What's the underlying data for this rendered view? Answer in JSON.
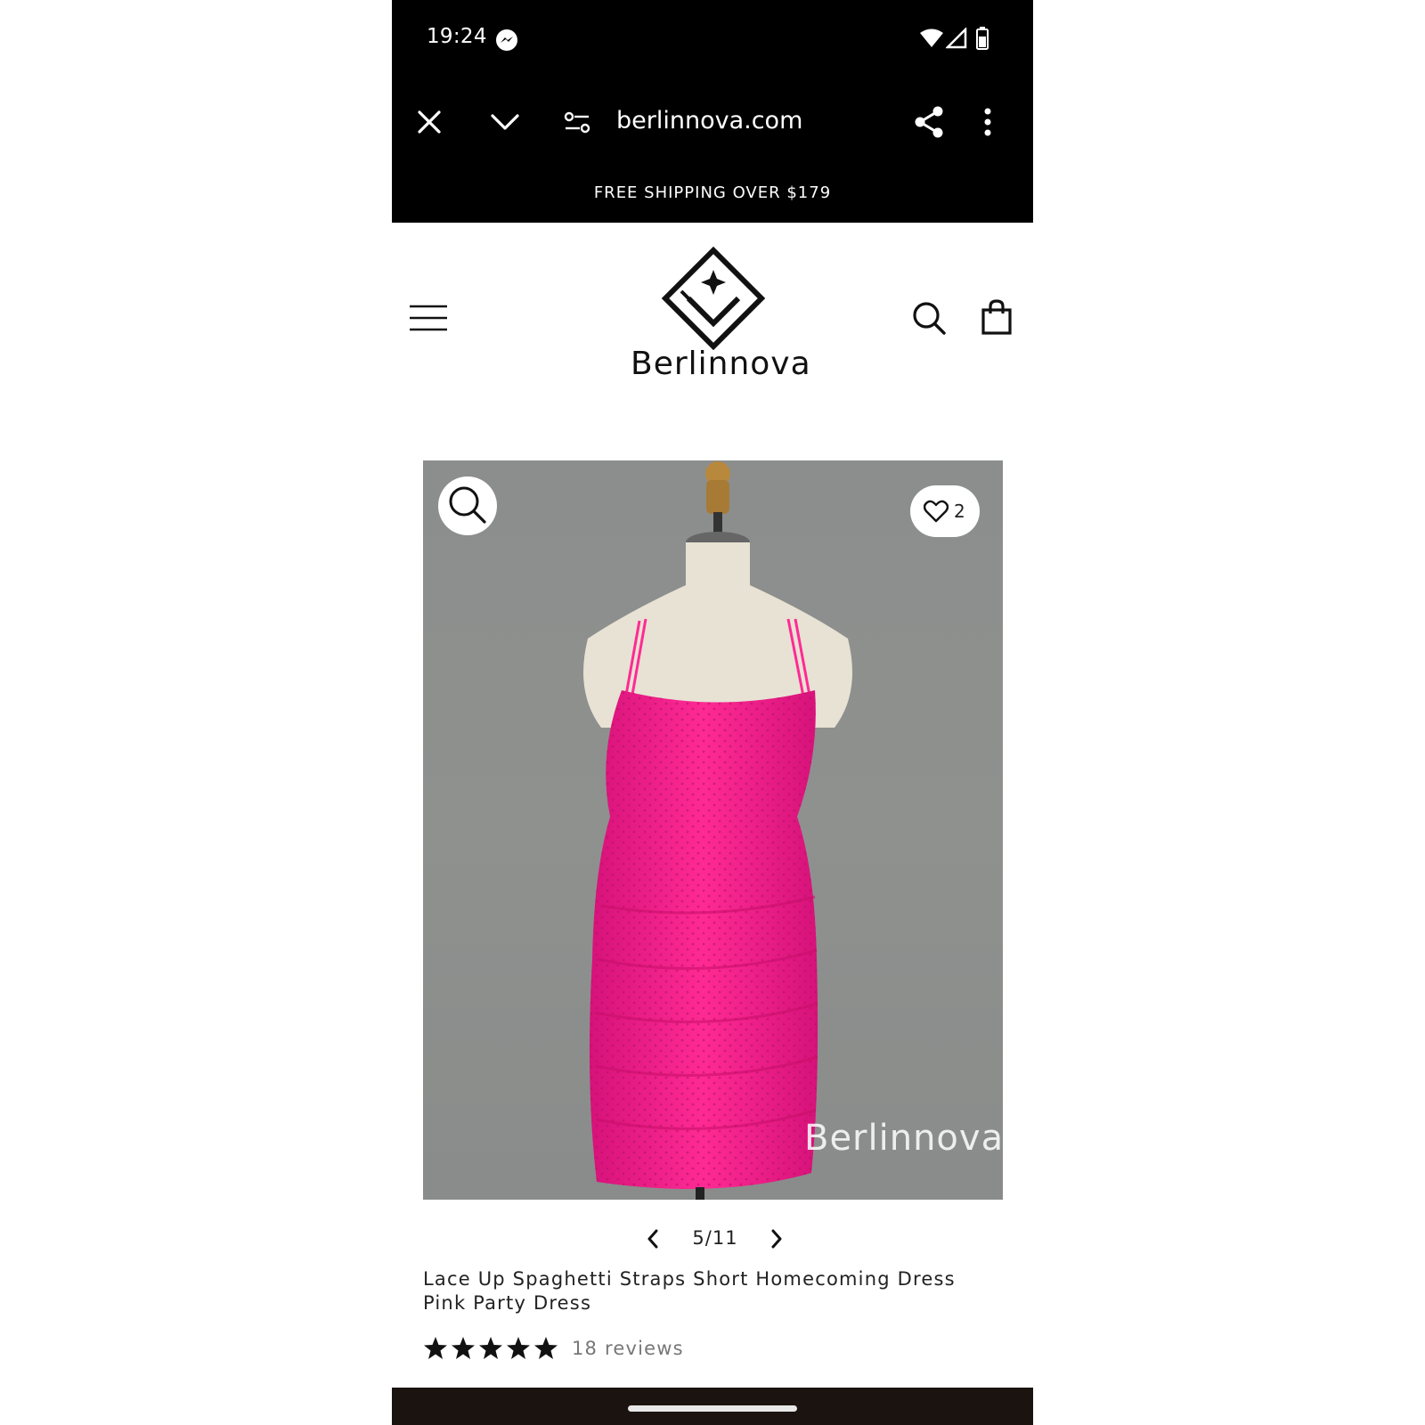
{
  "status_bar": {
    "time": "19:24"
  },
  "browser": {
    "url": "berlinnova.com"
  },
  "announcement": "FREE SHIPPING OVER $179",
  "site": {
    "logo_text": "Berlinnova"
  },
  "product": {
    "image_watermark": "Berlinnova",
    "wishlist_count": "2",
    "pager": "5/11",
    "title": "Lace Up Spaghetti Straps Short Homecoming Dress Pink Party Dress",
    "rating_stars": 5,
    "reviews_label": "18 reviews"
  },
  "colors": {
    "dress": "#ff1f8e",
    "image_bg": "#8e908f",
    "star": "#111111"
  }
}
